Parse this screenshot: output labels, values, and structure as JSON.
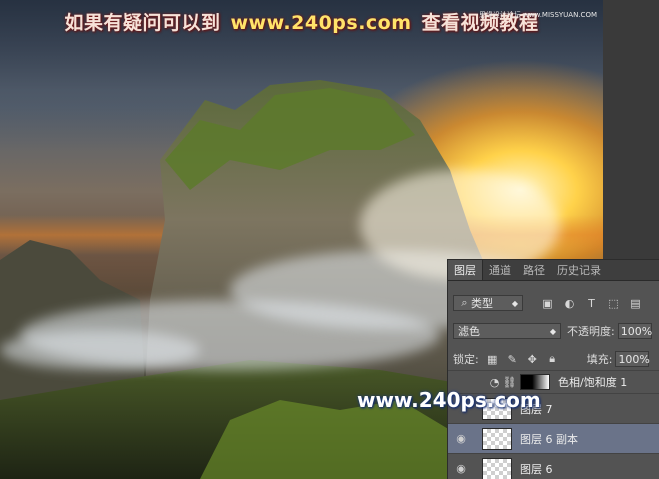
{
  "banner": {
    "prefix": "如果有疑问可以到",
    "url": "www.240ps.com",
    "suffix": "查看视频教程"
  },
  "credit": "思缘设计论坛 www.MISSYUAN.COM",
  "watermark": "www.240ps.com",
  "layers_panel": {
    "tabs": [
      "图层",
      "通道",
      "路径",
      "历史记录"
    ],
    "filter_kind": "类型",
    "filter_icons": [
      "image-filter-icon",
      "adjustment-filter-icon",
      "type-filter-icon",
      "shape-filter-icon",
      "smart-object-filter-icon"
    ],
    "blend_mode": "滤色",
    "opacity_label": "不透明度:",
    "opacity_value": "100%",
    "lock_label": "锁定:",
    "fill_label": "填充:",
    "fill_value": "100%",
    "layers": [
      {
        "name": "色相/饱和度 1",
        "visible": false,
        "type": "adjustment"
      },
      {
        "name": "图层 7",
        "visible": false,
        "type": "pixel"
      },
      {
        "name": "图层 6 副本",
        "visible": true,
        "type": "pixel",
        "selected": true
      },
      {
        "name": "图层 6",
        "visible": true,
        "type": "pixel"
      }
    ]
  }
}
